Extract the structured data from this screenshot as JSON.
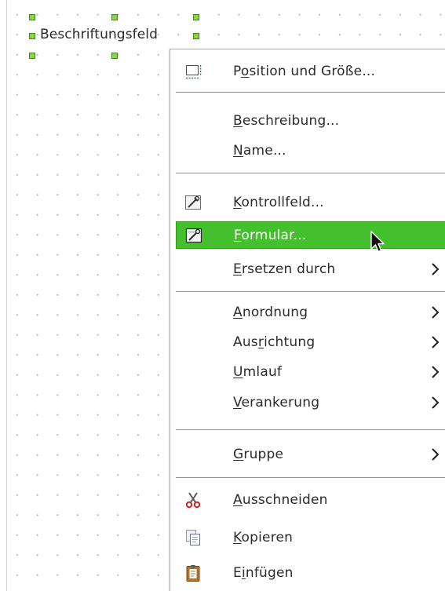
{
  "canvas": {
    "label_field_text": "Beschriftungsfeld"
  },
  "context_menu": {
    "items": [
      {
        "id": "position",
        "before": "P",
        "mnemonic": "o",
        "after": "sition und Größe...",
        "icon": "position-size-icon",
        "submenu": false
      },
      {
        "id": "beschreibung",
        "before": "",
        "mnemonic": "B",
        "after": "eschreibung...",
        "icon": null,
        "submenu": false
      },
      {
        "id": "name",
        "before": "",
        "mnemonic": "N",
        "after": "ame...",
        "icon": null,
        "submenu": false
      },
      {
        "id": "kontrollfeld",
        "before": "",
        "mnemonic": "K",
        "after": "ontrollfeld...",
        "icon": "control-properties-icon",
        "submenu": false
      },
      {
        "id": "formular",
        "before": "",
        "mnemonic": "F",
        "after": "ormular...",
        "icon": "form-properties-icon",
        "submenu": false,
        "highlighted": true
      },
      {
        "id": "ersetzen",
        "before": "",
        "mnemonic": "E",
        "after": "rsetzen durch",
        "icon": null,
        "submenu": true
      },
      {
        "id": "anordnung",
        "before": "",
        "mnemonic": "A",
        "after": "nordnung",
        "icon": null,
        "submenu": true
      },
      {
        "id": "ausrichtung",
        "before": "Aus",
        "mnemonic": "r",
        "after": "ichtung",
        "icon": null,
        "submenu": true
      },
      {
        "id": "umlauf",
        "before": "",
        "mnemonic": "U",
        "after": "mlauf",
        "icon": null,
        "submenu": true
      },
      {
        "id": "verankerung",
        "before": "",
        "mnemonic": "V",
        "after": "erankerung",
        "icon": null,
        "submenu": true
      },
      {
        "id": "gruppe",
        "before": "",
        "mnemonic": "G",
        "after": "ruppe",
        "icon": null,
        "submenu": true
      },
      {
        "id": "ausschneiden",
        "before": "",
        "mnemonic": "A",
        "after": "usschneiden",
        "icon": "scissors-icon",
        "submenu": false
      },
      {
        "id": "kopieren",
        "before": "",
        "mnemonic": "K",
        "after": "opieren",
        "icon": "copy-icon",
        "submenu": false
      },
      {
        "id": "einfuegen",
        "before": "E",
        "mnemonic": "i",
        "after": "nfügen",
        "icon": "clipboard-icon",
        "submenu": false
      }
    ]
  },
  "colors": {
    "highlight": "#44c02e",
    "handle": "#8ed24a"
  }
}
